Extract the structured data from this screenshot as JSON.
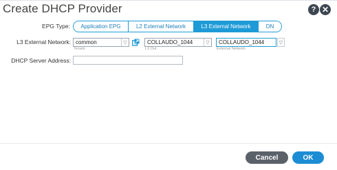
{
  "dialog": {
    "title": "Create DHCP Provider",
    "help_icon": "?",
    "close_icon": "✕"
  },
  "form": {
    "epg_type_label": "EPG Type:",
    "epg_types": [
      "Application EPG",
      "L2 External Network",
      "L3 External Network",
      "DN"
    ],
    "epg_type_selected": "L3 External Network",
    "l3_label": "L3 External Network:",
    "tenant_value": "common",
    "tenant_sub": "Tenant",
    "l3out_value": "COLLAUDO_1044",
    "l3out_sub": "L3 Out",
    "extnet_value": "COLLAUDO_1044",
    "extnet_sub": "External Network",
    "dhcp_label": "DHCP Server Address:",
    "dhcp_value": ""
  },
  "footer": {
    "cancel_label": "Cancel",
    "ok_label": "OK"
  },
  "colors": {
    "accent": "#1e9bd7",
    "ok": "#1c8dd4",
    "cancel": "#5a6169"
  },
  "icons": {
    "help": "help-icon",
    "close": "close-icon",
    "dropdown": "chevron-down-icon",
    "external": "open-external-icon"
  }
}
